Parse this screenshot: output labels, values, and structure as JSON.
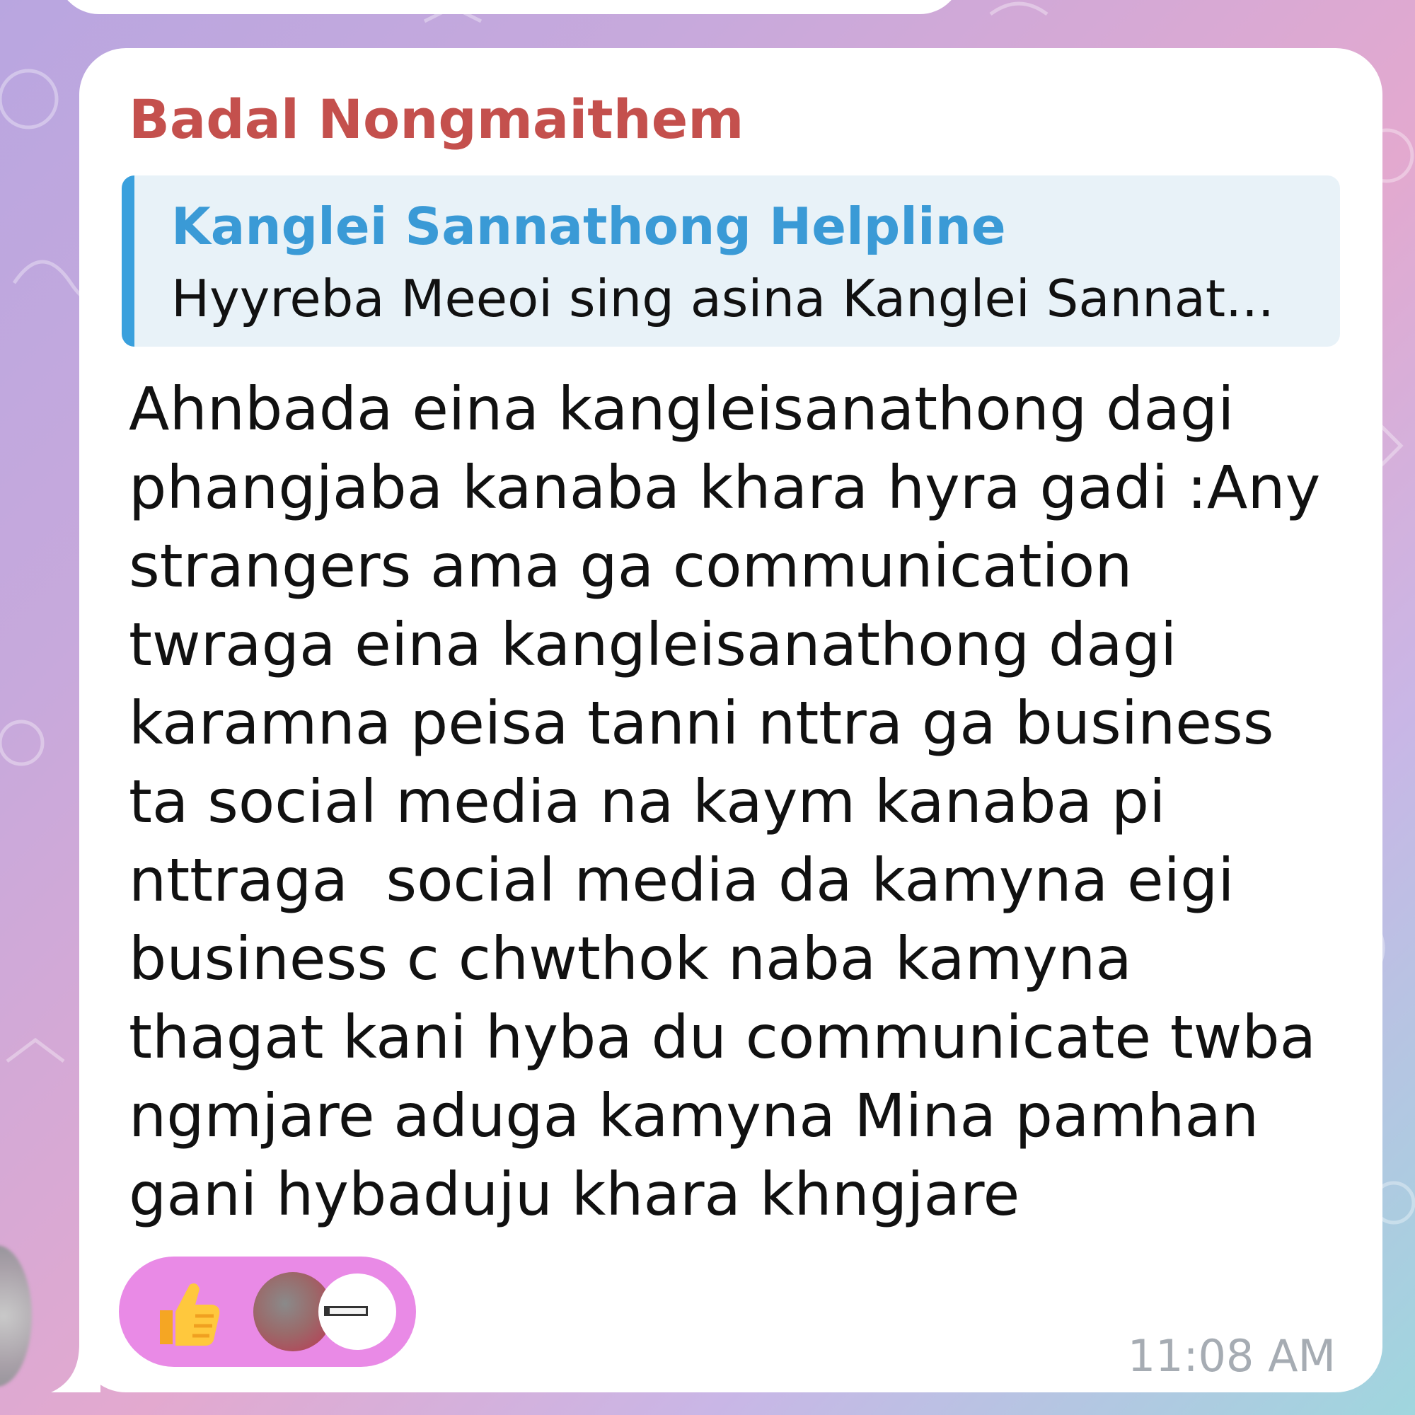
{
  "message": {
    "sender_name": "Badal Nongmaithem",
    "reply": {
      "title": "Kanglei Sannathong Helpline",
      "preview": "Hyyreba Meeoi sing asina Kanglei Sannat..."
    },
    "body_lines": [
      "Ahnbada eina kangleisanathong dagi",
      "phangjaba kanaba khara hyra gadi :Any",
      "strangers ama ga communication",
      "twraga eina kangleisanathong dagi",
      "karamna peisa tanni nttra ga business",
      "ta social media na kaym kanaba pi",
      "nttraga  social media da kamyna eigi",
      "business c chwthok naba kamyna",
      "thagat kani hyba du communicate twba",
      "ngmjare aduga kamyna Mina pamhan",
      "gani hybaduju khara khngjare"
    ],
    "reaction": {
      "emoji": "thumbs-up-icon"
    },
    "timestamp": "11:08 AM"
  },
  "colors": {
    "sender_name": "#c4504d",
    "reply_accent": "#3aa0dd",
    "reaction_bg": "#e98ae6",
    "timestamp": "#a6acb3"
  }
}
